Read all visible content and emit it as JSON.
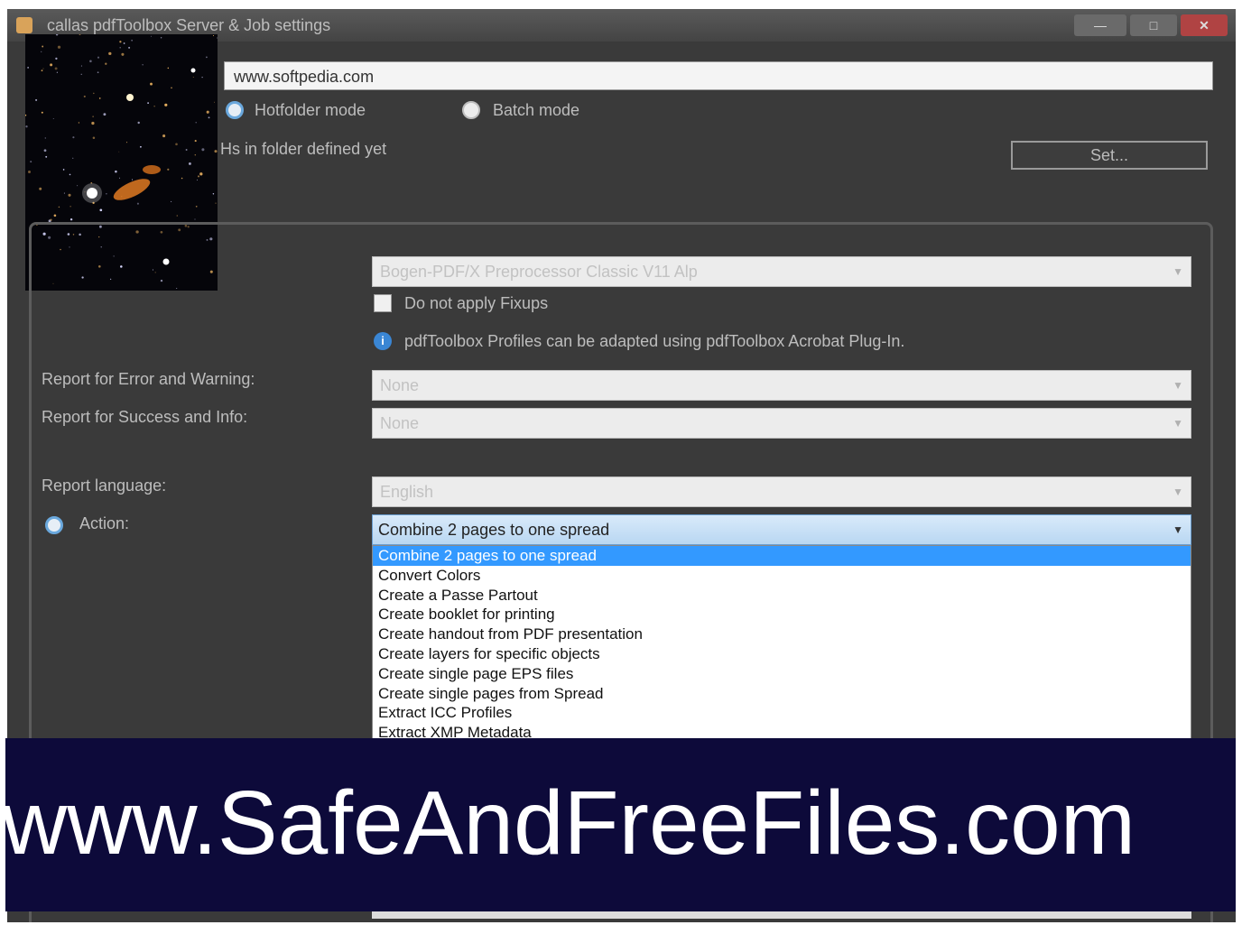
{
  "window": {
    "title": "callas pdfToolbox Server & Job settings",
    "minimize_label": "—",
    "maximize_label": "□",
    "close_label": "✕"
  },
  "thumbnail": {
    "description_icon": "galaxy-image"
  },
  "url_field": {
    "value": "www.softpedia.com"
  },
  "mode": {
    "hotfolder_label": "Hotfolder mode",
    "batch_label": "Batch mode",
    "selected": "hotfolder"
  },
  "folder_status": "Hs in folder defined yet",
  "set_button": "Set...",
  "profile": {
    "combo_value": "Bogen-PDF/X Preprocessor Classic V11 Alp",
    "no_fixups_label": "Do not apply Fixups",
    "info_text": "pdfToolbox Profiles can be adapted using pdfToolbox Acrobat Plug-In."
  },
  "reports": {
    "error_label": "Report for Error and Warning:",
    "error_value": "None",
    "success_label": "Report for Success and Info:",
    "success_value": "None",
    "language_label": "Report language:",
    "language_value": "English"
  },
  "actions": {
    "label": "Action:",
    "selected": "Combine 2 pages to one spread",
    "options": [
      "Combine 2 pages to one spread",
      "Convert Colors",
      "Create a Passe Partout",
      "Create booklet for printing",
      "Create handout from PDF presentation",
      "Create layers for specific objects",
      "Create single page EPS files",
      "Create single pages from Spread",
      "Extract ICC Profiles",
      "Extract XMP Metadata"
    ]
  },
  "watermark": {
    "text": "www.SafeAndFreeFiles.com"
  },
  "colors": {
    "window_bg": "#3a3a3a",
    "selection_blue": "#3399ff",
    "watermark_bg": "#0d0a3a"
  }
}
